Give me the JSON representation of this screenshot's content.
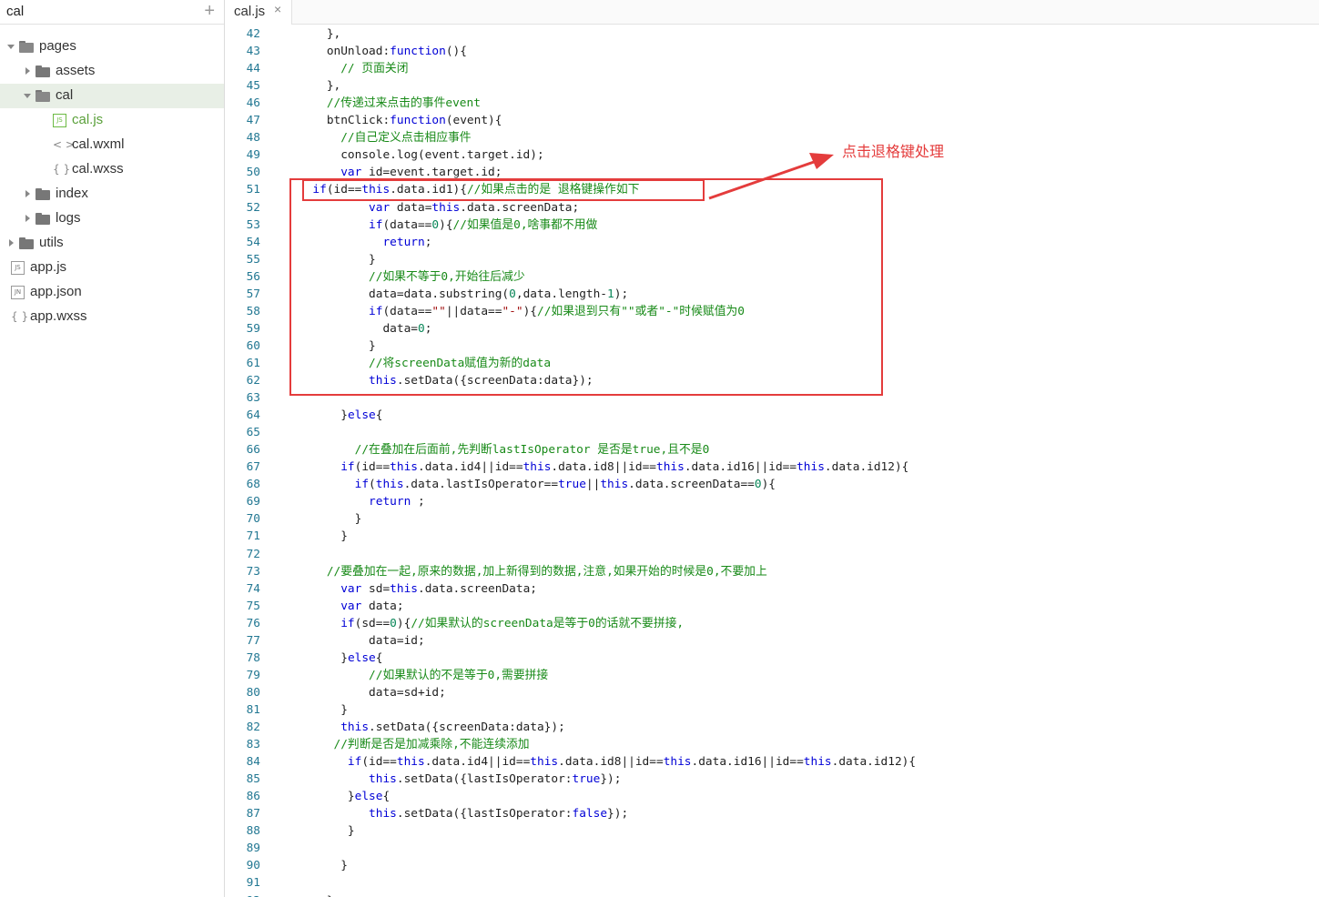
{
  "sidebar": {
    "title": "cal",
    "add_icon": "+",
    "tree": [
      {
        "label": "pages",
        "type": "folder",
        "expanded": true,
        "depth": 0
      },
      {
        "label": "assets",
        "type": "folder",
        "expanded": false,
        "depth": 1
      },
      {
        "label": "cal",
        "type": "folder",
        "expanded": true,
        "depth": 1,
        "selected": true
      },
      {
        "label": "cal.js",
        "type": "js",
        "depth": 2,
        "active": true
      },
      {
        "label": "cal.wxml",
        "type": "wxml",
        "depth": 2
      },
      {
        "label": "cal.wxss",
        "type": "wxss",
        "depth": 2
      },
      {
        "label": "index",
        "type": "folder",
        "expanded": false,
        "depth": 1
      },
      {
        "label": "logs",
        "type": "folder",
        "expanded": false,
        "depth": 1
      },
      {
        "label": "utils",
        "type": "folder",
        "expanded": false,
        "depth": 0
      },
      {
        "label": "app.js",
        "type": "js",
        "depth": 0
      },
      {
        "label": "app.json",
        "type": "json",
        "depth": 0
      },
      {
        "label": "app.wxss",
        "type": "wxss",
        "depth": 0
      }
    ]
  },
  "tab": {
    "label": "cal.js",
    "close": "×"
  },
  "icons": {
    "js": "JS",
    "json": "JN",
    "wxml": "< >",
    "wxss": "{ }"
  },
  "annotation": {
    "label": "点击退格键处理",
    "color": "#e43c3c"
  },
  "code_lines": [
    {
      "n": "42",
      "t": [
        [
          "",
          "    },"
        ]
      ]
    },
    {
      "n": "43",
      "t": [
        [
          "",
          "    onUnload:"
        ],
        [
          "kw",
          "function"
        ],
        [
          "",
          "(){"
        ]
      ]
    },
    {
      "n": "44",
      "t": [
        [
          "cm",
          "      // 页面关闭"
        ]
      ]
    },
    {
      "n": "45",
      "t": [
        [
          "",
          "    },"
        ]
      ]
    },
    {
      "n": "46",
      "t": [
        [
          "cm",
          "    //传递过来点击的事件event"
        ]
      ]
    },
    {
      "n": "47",
      "t": [
        [
          "",
          "    btnClick:"
        ],
        [
          "kw",
          "function"
        ],
        [
          "",
          "(event){"
        ]
      ]
    },
    {
      "n": "48",
      "t": [
        [
          "cm",
          "      //自己定义点击相应事件"
        ]
      ]
    },
    {
      "n": "49",
      "t": [
        [
          "",
          "      console.log(event.target.id);"
        ]
      ]
    },
    {
      "n": "50",
      "t": [
        [
          "kw",
          "      var"
        ],
        [
          "",
          " id=event.target.id;"
        ]
      ]
    },
    {
      "n": "51",
      "t": [
        [
          "kw",
          "  if"
        ],
        [
          "",
          "(id=="
        ],
        [
          "kw",
          "this"
        ],
        [
          "",
          ".data.id1){"
        ],
        [
          "cm",
          "//如果点击的是 退格键操作如下"
        ]
      ]
    },
    {
      "n": "52",
      "t": [
        [
          "kw",
          "          var"
        ],
        [
          "",
          " data="
        ],
        [
          "kw",
          "this"
        ],
        [
          "",
          ".data.screenData;"
        ]
      ]
    },
    {
      "n": "53",
      "t": [
        [
          "kw",
          "          if"
        ],
        [
          "",
          "(data=="
        ],
        [
          "nm",
          "0"
        ],
        [
          "",
          "){"
        ],
        [
          "cm",
          "//如果值是0,啥事都不用做"
        ]
      ]
    },
    {
      "n": "54",
      "t": [
        [
          "kw",
          "            return"
        ],
        [
          "",
          ";"
        ]
      ]
    },
    {
      "n": "55",
      "t": [
        [
          "",
          "          }"
        ]
      ]
    },
    {
      "n": "56",
      "t": [
        [
          "cm",
          "          //如果不等于0,开始往后减少"
        ]
      ]
    },
    {
      "n": "57",
      "t": [
        [
          "",
          "          data=data.substring("
        ],
        [
          "nm",
          "0"
        ],
        [
          "",
          ",data.length-"
        ],
        [
          "nm",
          "1"
        ],
        [
          "",
          ");"
        ]
      ]
    },
    {
      "n": "58",
      "t": [
        [
          "kw",
          "          if"
        ],
        [
          "",
          "(data=="
        ],
        [
          "st",
          "\"\""
        ],
        [
          "",
          "||data=="
        ],
        [
          "st",
          "\"-\""
        ],
        [
          "",
          "){"
        ],
        [
          "cm",
          "//如果退到只有\"\"或者\"-\"时候赋值为0"
        ]
      ]
    },
    {
      "n": "59",
      "t": [
        [
          "",
          "            data="
        ],
        [
          "nm",
          "0"
        ],
        [
          "",
          ";"
        ]
      ]
    },
    {
      "n": "60",
      "t": [
        [
          "",
          "          }"
        ]
      ]
    },
    {
      "n": "61",
      "t": [
        [
          "cm",
          "          //将screenData赋值为新的data"
        ]
      ]
    },
    {
      "n": "62",
      "t": [
        [
          "kw",
          "          this"
        ],
        [
          "",
          ".setData({screenData:data});"
        ]
      ]
    },
    {
      "n": "63",
      "t": [
        [
          "",
          ""
        ]
      ]
    },
    {
      "n": "64",
      "t": [
        [
          "",
          "      }"
        ],
        [
          "kw",
          "else"
        ],
        [
          "",
          "{"
        ]
      ]
    },
    {
      "n": "65",
      "t": [
        [
          "",
          ""
        ]
      ]
    },
    {
      "n": "66",
      "t": [
        [
          "cm",
          "        //在叠加在后面前,先判断lastIsOperator 是否是true,且不是0"
        ]
      ]
    },
    {
      "n": "67",
      "t": [
        [
          "kw",
          "      if"
        ],
        [
          "",
          "(id=="
        ],
        [
          "kw",
          "this"
        ],
        [
          "",
          ".data.id4||id=="
        ],
        [
          "kw",
          "this"
        ],
        [
          "",
          ".data.id8||id=="
        ],
        [
          "kw",
          "this"
        ],
        [
          "",
          ".data.id16||id=="
        ],
        [
          "kw",
          "this"
        ],
        [
          "",
          ".data.id12){"
        ]
      ]
    },
    {
      "n": "68",
      "t": [
        [
          "kw",
          "        if"
        ],
        [
          "",
          "("
        ],
        [
          "kw",
          "this"
        ],
        [
          "",
          ".data.lastIsOperator=="
        ],
        [
          "kw",
          "true"
        ],
        [
          "",
          "||"
        ],
        [
          "kw",
          "this"
        ],
        [
          "",
          ".data.screenData=="
        ],
        [
          "nm",
          "0"
        ],
        [
          "",
          "){"
        ]
      ]
    },
    {
      "n": "69",
      "t": [
        [
          "kw",
          "          return"
        ],
        [
          "",
          " ;"
        ]
      ]
    },
    {
      "n": "70",
      "t": [
        [
          "",
          "        }"
        ]
      ]
    },
    {
      "n": "71",
      "t": [
        [
          "",
          "      }"
        ]
      ]
    },
    {
      "n": "72",
      "t": [
        [
          "",
          ""
        ]
      ]
    },
    {
      "n": "73",
      "t": [
        [
          "cm",
          "    //要叠加在一起,原来的数据,加上新得到的数据,注意,如果开始的时候是0,不要加上"
        ]
      ]
    },
    {
      "n": "74",
      "t": [
        [
          "kw",
          "      var"
        ],
        [
          "",
          " sd="
        ],
        [
          "kw",
          "this"
        ],
        [
          "",
          ".data.screenData;"
        ]
      ]
    },
    {
      "n": "75",
      "t": [
        [
          "kw",
          "      var"
        ],
        [
          "",
          " data;"
        ]
      ]
    },
    {
      "n": "76",
      "t": [
        [
          "kw",
          "      if"
        ],
        [
          "",
          "(sd=="
        ],
        [
          "nm",
          "0"
        ],
        [
          "",
          "){"
        ],
        [
          "cm",
          "//如果默认的screenData是等于0的话就不要拼接,"
        ]
      ]
    },
    {
      "n": "77",
      "t": [
        [
          "",
          "          data=id;"
        ]
      ]
    },
    {
      "n": "78",
      "t": [
        [
          "",
          "      }"
        ],
        [
          "kw",
          "else"
        ],
        [
          "",
          "{"
        ]
      ]
    },
    {
      "n": "79",
      "t": [
        [
          "cm",
          "          //如果默认的不是等于0,需要拼接"
        ]
      ]
    },
    {
      "n": "80",
      "t": [
        [
          "",
          "          data=sd+id;"
        ]
      ]
    },
    {
      "n": "81",
      "t": [
        [
          "",
          "      }"
        ]
      ]
    },
    {
      "n": "82",
      "t": [
        [
          "kw",
          "      this"
        ],
        [
          "",
          ".setData({screenData:data});"
        ]
      ]
    },
    {
      "n": "83",
      "t": [
        [
          "cm",
          "     //判断是否是加减乘除,不能连续添加"
        ]
      ]
    },
    {
      "n": "84",
      "t": [
        [
          "kw",
          "       if"
        ],
        [
          "",
          "(id=="
        ],
        [
          "kw",
          "this"
        ],
        [
          "",
          ".data.id4||id=="
        ],
        [
          "kw",
          "this"
        ],
        [
          "",
          ".data.id8||id=="
        ],
        [
          "kw",
          "this"
        ],
        [
          "",
          ".data.id16||id=="
        ],
        [
          "kw",
          "this"
        ],
        [
          "",
          ".data.id12){"
        ]
      ]
    },
    {
      "n": "85",
      "t": [
        [
          "kw",
          "          this"
        ],
        [
          "",
          ".setData({lastIsOperator:"
        ],
        [
          "kw",
          "true"
        ],
        [
          "",
          "});"
        ]
      ]
    },
    {
      "n": "86",
      "t": [
        [
          "",
          "       }"
        ],
        [
          "kw",
          "else"
        ],
        [
          "",
          "{"
        ]
      ]
    },
    {
      "n": "87",
      "t": [
        [
          "kw",
          "          this"
        ],
        [
          "",
          ".setData({lastIsOperator:"
        ],
        [
          "kw",
          "false"
        ],
        [
          "",
          "});"
        ]
      ]
    },
    {
      "n": "88",
      "t": [
        [
          "",
          "       }"
        ]
      ]
    },
    {
      "n": "89",
      "t": [
        [
          "",
          ""
        ]
      ]
    },
    {
      "n": "90",
      "t": [
        [
          "",
          "      }"
        ]
      ]
    },
    {
      "n": "91",
      "t": [
        [
          "",
          ""
        ]
      ]
    },
    {
      "n": "92",
      "t": [
        [
          "",
          "    },"
        ]
      ]
    }
  ]
}
